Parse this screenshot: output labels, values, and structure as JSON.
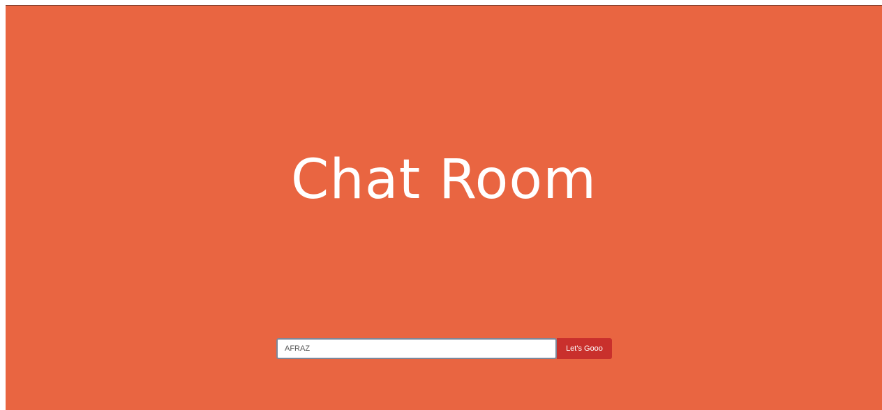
{
  "page": {
    "title": "Chat Room",
    "background_color": "#e96541"
  },
  "join_form": {
    "name_value": "AFRAZ",
    "submit_label": "Let's Gooo",
    "button_color": "#c9302c"
  }
}
